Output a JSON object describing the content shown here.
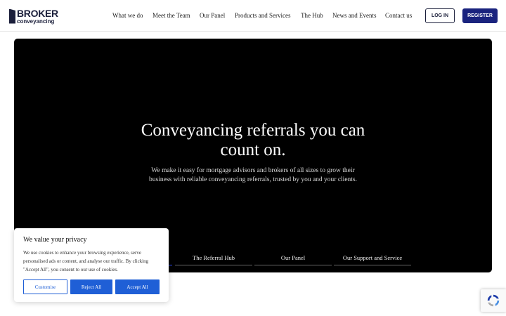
{
  "header": {
    "logo_top": "BROKER",
    "logo_bottom": "conveyancing",
    "nav": [
      {
        "label": "What we do"
      },
      {
        "label": "Meet the Team"
      },
      {
        "label": "Our Panel"
      },
      {
        "label": "Products and Services"
      },
      {
        "label": "The Hub"
      },
      {
        "label": "News and Events"
      },
      {
        "label": "Contact us"
      }
    ],
    "login_label": "LOG IN",
    "register_label": "REGISTER"
  },
  "hero": {
    "title_line1": "Conveyancing referrals you can",
    "title_line2": "count on.",
    "subtitle_line1": "We make it easy for mortgage advisors and brokers of all sizes to grow their",
    "subtitle_line2": "business with reliable conveyancing referrals, trusted by you and your clients.",
    "tabs": [
      {
        "label": "The Referral Hub"
      },
      {
        "label": "Our Panel"
      },
      {
        "label": "Our Support and Service"
      }
    ]
  },
  "cookie_banner": {
    "title": "We value your privacy",
    "text": "We use cookies to enhance your browsing experience, serve personalised ads or content, and analyse our traffic. By clicking \"Accept All\", you consent to our use of cookies.",
    "customise_label": "Customise",
    "reject_label": "Reject All",
    "accept_label": "Accept All"
  },
  "colors": {
    "brand_navy": "#1b1f3b",
    "register_bg": "#1a237e",
    "cookie_blue": "#1f5fd6",
    "active_tab": "#2f4cff"
  },
  "icons": {
    "recaptcha": "recaptcha-icon"
  }
}
